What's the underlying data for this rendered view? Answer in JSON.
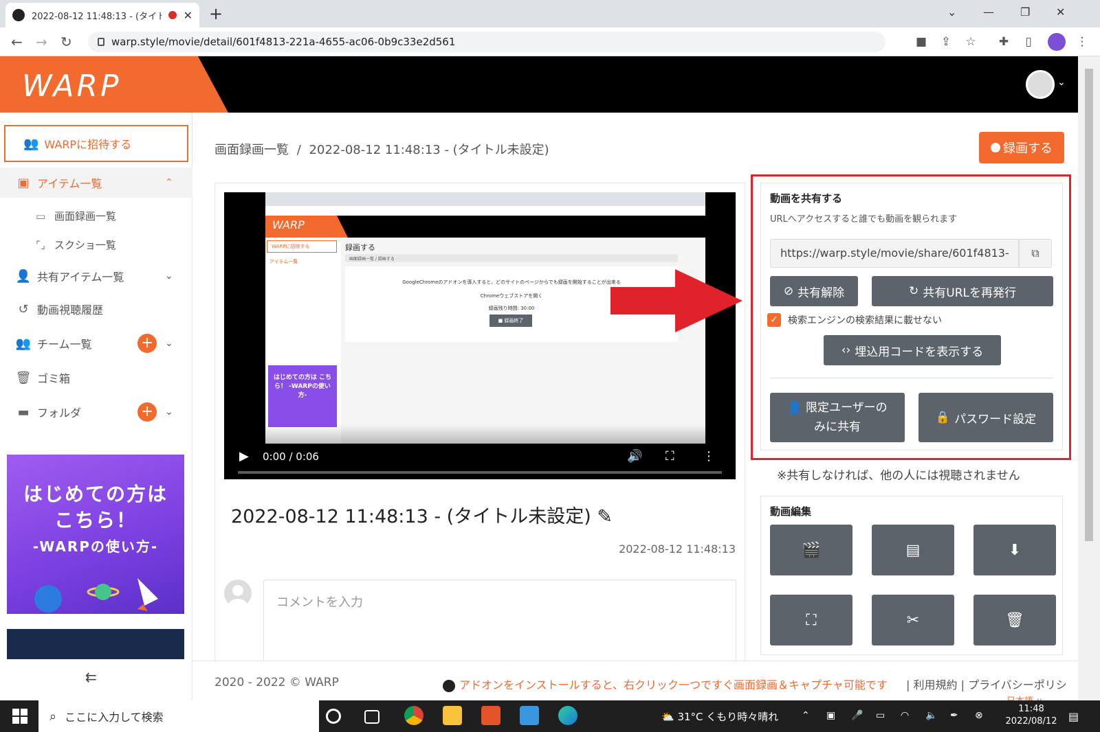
{
  "browser": {
    "tab_title": "2022-08-12 11:48:13 - (タイト",
    "url": "warp.style/movie/detail/601f4813-221a-4655-ac06-0b9c33e2d561"
  },
  "app": {
    "logo": "WARP"
  },
  "sidebar": {
    "invite_label": "WARPに招待する",
    "items_label": "アイテム一覧",
    "sub_recordings": "画面録画一覧",
    "sub_screenshots": "スクショ一覧",
    "shared_items": "共有アイテム一覧",
    "history": "動画視聴履歴",
    "teams": "チーム一覧",
    "trash": "ゴミ箱",
    "folders": "フォルダ",
    "promo_line1": "はじめての方は",
    "promo_line2": "こちら！",
    "promo_line3": "-WARPの使い方-"
  },
  "main": {
    "breadcrumb_parent": "画面録画一覧",
    "breadcrumb_sep": "/",
    "breadcrumb_current": "2022-08-12 11:48:13 - (タイトル未設定)",
    "record_button": "録画する",
    "video_time": "0:00 / 0:06",
    "video_progress": 0.0,
    "video_title": "2022-08-12 11:48:13 - (タイトル未設定)",
    "video_date": "2022-08-12 11:48:13",
    "comment_placeholder": "コメントを入力"
  },
  "video_preview": {
    "page_heading": "録画する",
    "breadcrumb": "画面録画一覧 / 録画する",
    "message": "GoogleChromeのアドオンを導入すると、どのサイトのページからでも録画を開始することが出来る",
    "store_link": "Chromeウェブストアを開く",
    "remaining": "録画残り時間: 30:00",
    "stop_button": "■ 録画終了",
    "invite": "WARPに招待する",
    "items": "アイテム一覧",
    "promo": "はじめての方は こちら！ -WARPの使い方-"
  },
  "share": {
    "title": "動画を共有する",
    "description": "URLへアクセスすると誰でも動画を観られます",
    "url": "https://warp.style/movie/share/601f4813-",
    "unshare_button": "共有解除",
    "reissue_button": "共有URLを再発行",
    "seo_label": "検索エンジンの検索結果に載せない",
    "seo_checked": true,
    "embed_button": "埋込用コードを表示する",
    "limited_button_l1": "限定ユーザーの",
    "limited_button_l2": "みに共有",
    "password_button": "パスワード設定",
    "note": "※共有しなければ、他の人には視聴されません"
  },
  "edit": {
    "title": "動画編集",
    "buttons": [
      "clapper-edit-icon",
      "subtitles-icon",
      "download-icon",
      "fullscreen-crop-icon",
      "cut-icon",
      "trash-icon"
    ]
  },
  "footer": {
    "copyright": "2020 - 2022 © WARP",
    "addon_message": "アドオンをインストールすると、右クリック一つですぐ画面録画＆キャプチャ可能です",
    "terms": "利用規約",
    "privacy": "プライバシーポリシ",
    "link_sep": "|",
    "language": "日本語 ∨"
  },
  "taskbar": {
    "search_placeholder": "ここに入力して検索",
    "weather": "31°C くもり時々晴れ",
    "time": "11:48",
    "date": "2022/08/12"
  },
  "colors": {
    "brand": "#f26a2e",
    "button_gray": "#5d636b",
    "highlight_red": "#e0222a"
  }
}
